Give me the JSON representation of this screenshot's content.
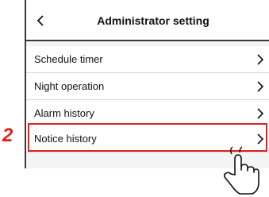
{
  "header": {
    "title": "Administrator setting"
  },
  "menu": {
    "items": [
      {
        "label": "Schedule timer"
      },
      {
        "label": "Night operation"
      },
      {
        "label": "Alarm history"
      },
      {
        "label": "Notice history"
      }
    ]
  },
  "annotation": {
    "step_number": "2",
    "highlight_color": "#e02020"
  },
  "icons": {
    "back": "chevron-left-icon",
    "row_arrow": "chevron-right-icon",
    "pointer": "tap-hand-icon"
  }
}
